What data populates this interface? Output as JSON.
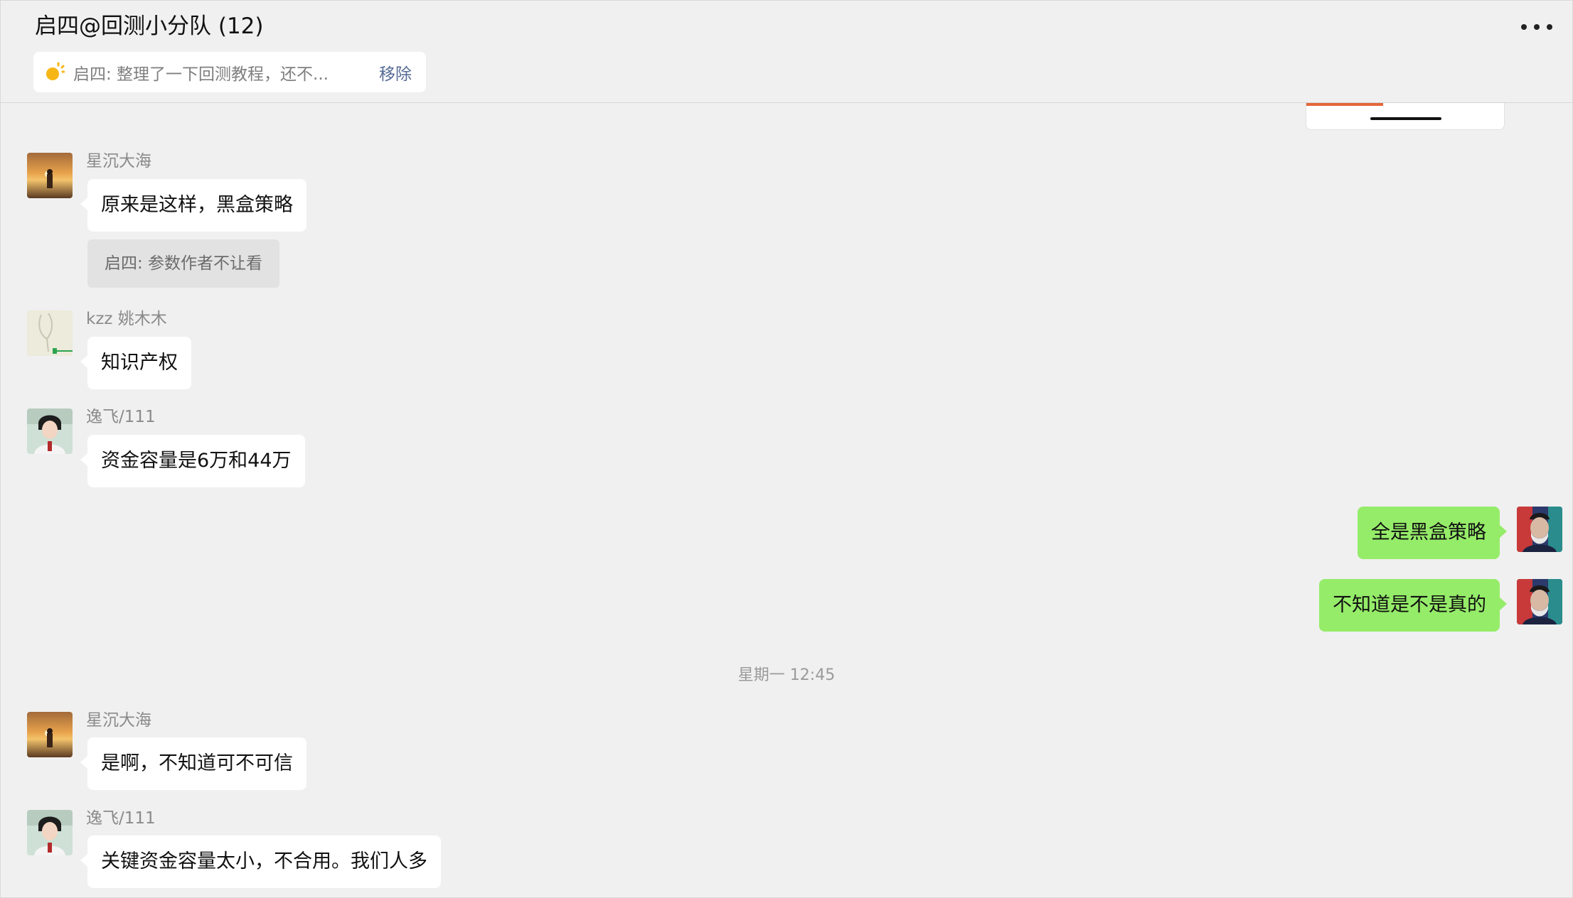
{
  "header": {
    "title": "启四@回测小分队 (12)",
    "pinned_text": "启四: 整理了一下回测教程，还不...",
    "pinned_remove": "移除"
  },
  "messages": [
    {
      "sender": "星沉大海",
      "text": "原来是这样，黑盒策略",
      "quote": "启四: 参数作者不让看"
    },
    {
      "sender": "kzz 姚木木",
      "text": "知识产权"
    },
    {
      "sender": "逸飞/111",
      "text": "资金容量是6万和44万"
    },
    {
      "self": true,
      "text": "全是黑盒策略"
    },
    {
      "self": true,
      "text": "不知道是不是真的"
    },
    {
      "timestamp": "星期一 12:45"
    },
    {
      "sender": "星沉大海",
      "text": "是啊，不知道可不可信"
    },
    {
      "sender": "逸飞/111",
      "text": "关键资金容量太小，不合用。我们人多"
    }
  ],
  "colors": {
    "self_bubble": "#95ec69",
    "other_bubble": "#ffffff",
    "link": "#576b95",
    "background": "#f0f0f0"
  },
  "icons": {
    "more": "more-dots-icon",
    "pin": "sun-pin-icon"
  }
}
